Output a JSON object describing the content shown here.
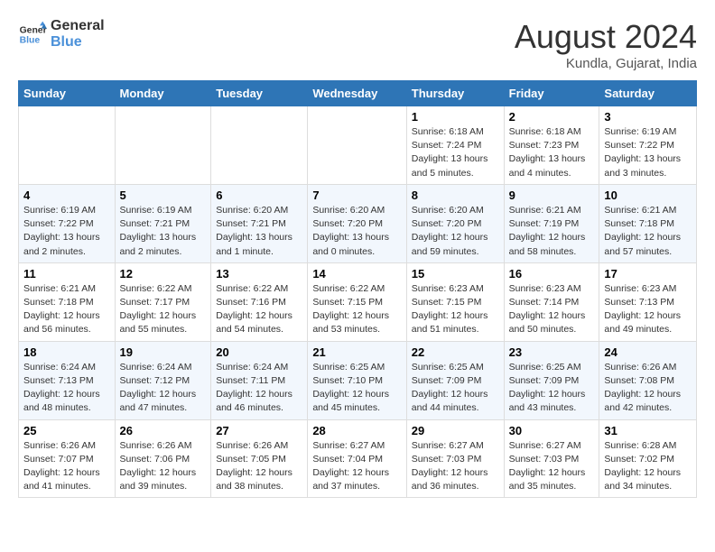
{
  "logo": {
    "line1": "General",
    "line2": "Blue"
  },
  "title": "August 2024",
  "subtitle": "Kundla, Gujarat, India",
  "days_of_week": [
    "Sunday",
    "Monday",
    "Tuesday",
    "Wednesday",
    "Thursday",
    "Friday",
    "Saturday"
  ],
  "weeks": [
    [
      {
        "day": "",
        "info": ""
      },
      {
        "day": "",
        "info": ""
      },
      {
        "day": "",
        "info": ""
      },
      {
        "day": "",
        "info": ""
      },
      {
        "day": "1",
        "info": "Sunrise: 6:18 AM\nSunset: 7:24 PM\nDaylight: 13 hours\nand 5 minutes."
      },
      {
        "day": "2",
        "info": "Sunrise: 6:18 AM\nSunset: 7:23 PM\nDaylight: 13 hours\nand 4 minutes."
      },
      {
        "day": "3",
        "info": "Sunrise: 6:19 AM\nSunset: 7:22 PM\nDaylight: 13 hours\nand 3 minutes."
      }
    ],
    [
      {
        "day": "4",
        "info": "Sunrise: 6:19 AM\nSunset: 7:22 PM\nDaylight: 13 hours\nand 2 minutes."
      },
      {
        "day": "5",
        "info": "Sunrise: 6:19 AM\nSunset: 7:21 PM\nDaylight: 13 hours\nand 2 minutes."
      },
      {
        "day": "6",
        "info": "Sunrise: 6:20 AM\nSunset: 7:21 PM\nDaylight: 13 hours\nand 1 minute."
      },
      {
        "day": "7",
        "info": "Sunrise: 6:20 AM\nSunset: 7:20 PM\nDaylight: 13 hours\nand 0 minutes."
      },
      {
        "day": "8",
        "info": "Sunrise: 6:20 AM\nSunset: 7:20 PM\nDaylight: 12 hours\nand 59 minutes."
      },
      {
        "day": "9",
        "info": "Sunrise: 6:21 AM\nSunset: 7:19 PM\nDaylight: 12 hours\nand 58 minutes."
      },
      {
        "day": "10",
        "info": "Sunrise: 6:21 AM\nSunset: 7:18 PM\nDaylight: 12 hours\nand 57 minutes."
      }
    ],
    [
      {
        "day": "11",
        "info": "Sunrise: 6:21 AM\nSunset: 7:18 PM\nDaylight: 12 hours\nand 56 minutes."
      },
      {
        "day": "12",
        "info": "Sunrise: 6:22 AM\nSunset: 7:17 PM\nDaylight: 12 hours\nand 55 minutes."
      },
      {
        "day": "13",
        "info": "Sunrise: 6:22 AM\nSunset: 7:16 PM\nDaylight: 12 hours\nand 54 minutes."
      },
      {
        "day": "14",
        "info": "Sunrise: 6:22 AM\nSunset: 7:15 PM\nDaylight: 12 hours\nand 53 minutes."
      },
      {
        "day": "15",
        "info": "Sunrise: 6:23 AM\nSunset: 7:15 PM\nDaylight: 12 hours\nand 51 minutes."
      },
      {
        "day": "16",
        "info": "Sunrise: 6:23 AM\nSunset: 7:14 PM\nDaylight: 12 hours\nand 50 minutes."
      },
      {
        "day": "17",
        "info": "Sunrise: 6:23 AM\nSunset: 7:13 PM\nDaylight: 12 hours\nand 49 minutes."
      }
    ],
    [
      {
        "day": "18",
        "info": "Sunrise: 6:24 AM\nSunset: 7:13 PM\nDaylight: 12 hours\nand 48 minutes."
      },
      {
        "day": "19",
        "info": "Sunrise: 6:24 AM\nSunset: 7:12 PM\nDaylight: 12 hours\nand 47 minutes."
      },
      {
        "day": "20",
        "info": "Sunrise: 6:24 AM\nSunset: 7:11 PM\nDaylight: 12 hours\nand 46 minutes."
      },
      {
        "day": "21",
        "info": "Sunrise: 6:25 AM\nSunset: 7:10 PM\nDaylight: 12 hours\nand 45 minutes."
      },
      {
        "day": "22",
        "info": "Sunrise: 6:25 AM\nSunset: 7:09 PM\nDaylight: 12 hours\nand 44 minutes."
      },
      {
        "day": "23",
        "info": "Sunrise: 6:25 AM\nSunset: 7:09 PM\nDaylight: 12 hours\nand 43 minutes."
      },
      {
        "day": "24",
        "info": "Sunrise: 6:26 AM\nSunset: 7:08 PM\nDaylight: 12 hours\nand 42 minutes."
      }
    ],
    [
      {
        "day": "25",
        "info": "Sunrise: 6:26 AM\nSunset: 7:07 PM\nDaylight: 12 hours\nand 41 minutes."
      },
      {
        "day": "26",
        "info": "Sunrise: 6:26 AM\nSunset: 7:06 PM\nDaylight: 12 hours\nand 39 minutes."
      },
      {
        "day": "27",
        "info": "Sunrise: 6:26 AM\nSunset: 7:05 PM\nDaylight: 12 hours\nand 38 minutes."
      },
      {
        "day": "28",
        "info": "Sunrise: 6:27 AM\nSunset: 7:04 PM\nDaylight: 12 hours\nand 37 minutes."
      },
      {
        "day": "29",
        "info": "Sunrise: 6:27 AM\nSunset: 7:03 PM\nDaylight: 12 hours\nand 36 minutes."
      },
      {
        "day": "30",
        "info": "Sunrise: 6:27 AM\nSunset: 7:03 PM\nDaylight: 12 hours\nand 35 minutes."
      },
      {
        "day": "31",
        "info": "Sunrise: 6:28 AM\nSunset: 7:02 PM\nDaylight: 12 hours\nand 34 minutes."
      }
    ]
  ]
}
